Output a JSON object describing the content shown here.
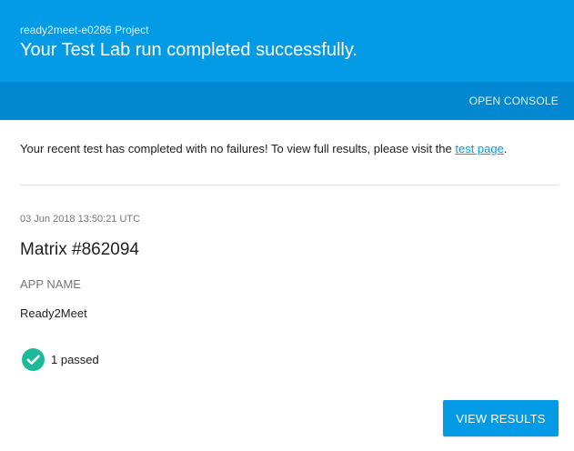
{
  "header": {
    "project_name": "ready2meet-e0286 Project",
    "headline": "Your Test Lab run completed successfully.",
    "open_console_label": "OPEN CONSOLE",
    "color_primary": "#039be5",
    "color_bar": "#0288d1"
  },
  "message": {
    "text": "Your recent test has completed with no failures! To view full results, please visit the ",
    "link_text": "test page",
    "suffix": "."
  },
  "matrix": {
    "timestamp": "03 Jun 2018 13:50:21 UTC",
    "title": "Matrix #862094",
    "app_name_label": "APP NAME",
    "app_name_value": "Ready2Meet",
    "result_icon": "check-circle-icon",
    "result_color": "#1db99a",
    "result_text": "1 passed"
  },
  "actions": {
    "view_results_label": "VIEW RESULTS"
  }
}
